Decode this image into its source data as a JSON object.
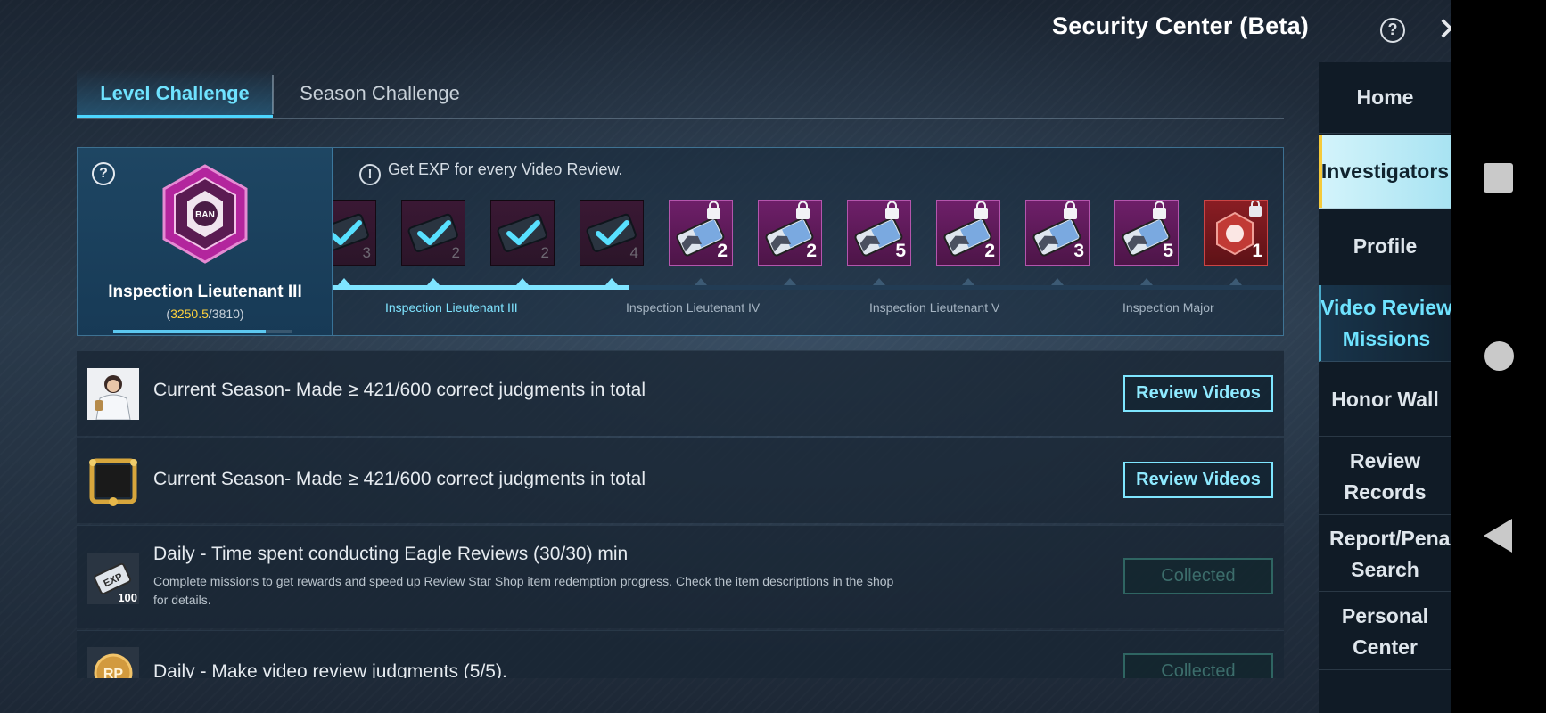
{
  "header": {
    "title": "Security Center (Beta)",
    "help_icon": "question-circle-icon",
    "close_icon": "close-icon"
  },
  "tabs": [
    {
      "label": "Level Challenge",
      "active": true
    },
    {
      "label": "Season Challenge",
      "active": false
    }
  ],
  "level": {
    "rank_name": "Inspection Lieutenant III",
    "exp_open": "(",
    "exp_current": "3250.5",
    "exp_rest": "/3810)",
    "exp_progress": 0.853,
    "hint": "Get EXP for every Video Review.",
    "rewards": [
      {
        "count": "3",
        "state": "done"
      },
      {
        "count": "2",
        "state": "done"
      },
      {
        "count": "2",
        "state": "done"
      },
      {
        "count": "4",
        "state": "done"
      },
      {
        "count": "2",
        "state": "locked"
      },
      {
        "count": "2",
        "state": "locked"
      },
      {
        "count": "5",
        "state": "locked"
      },
      {
        "count": "2",
        "state": "locked"
      },
      {
        "count": "3",
        "state": "locked"
      },
      {
        "count": "5",
        "state": "locked"
      },
      {
        "count": "1",
        "state": "locked-badge"
      }
    ],
    "track_progress": 0.31,
    "levels": [
      "Inspection Lieutenant III",
      "Inspection Lieutenant IV",
      "Inspection Lieutenant V",
      "Inspection Major"
    ]
  },
  "missions": [
    {
      "title": "Current Season- Made  ≥ 421/600 correct judgments in total",
      "description": "",
      "button": "Review Videos",
      "button_state": "active",
      "icon": "avatar-reward-icon"
    },
    {
      "title": "Current Season- Made  ≥ 421/600 correct judgments in total",
      "description": "",
      "button": "Review Videos",
      "button_state": "active",
      "icon": "gold-frame-icon"
    },
    {
      "title": "Daily - Time spent conducting Eagle Reviews (30/30) min",
      "description": "Complete missions to get rewards and speed up Review Star Shop item redemption progress. Check the item descriptions in the shop for details.",
      "button": "Collected",
      "button_state": "collected",
      "icon": "exp-card-icon",
      "icon_label": "100"
    },
    {
      "title": "Daily - Make video review judgments (5/5).",
      "description": "",
      "button": "Collected",
      "button_state": "collected",
      "icon": "rp-coin-icon"
    }
  ],
  "sidebar": [
    {
      "label": "Home",
      "state": "normal"
    },
    {
      "label": "Investigators",
      "state": "active"
    },
    {
      "label": "Profile",
      "state": "normal"
    },
    {
      "label": "Video Review Missions",
      "label_lines": [
        "Video Review",
        "Missions"
      ],
      "state": "hilite"
    },
    {
      "label": "Honor Wall",
      "state": "normal"
    },
    {
      "label": "Review Records",
      "label_lines": [
        "Review",
        "Records"
      ],
      "state": "normal"
    },
    {
      "label": "Report/Penalty Search",
      "label_lines": [
        "Report/Penalty",
        "Search"
      ],
      "state": "normal"
    },
    {
      "label": "Personal Center",
      "label_lines": [
        "Personal",
        "Center"
      ],
      "state": "normal"
    }
  ],
  "colors": {
    "accent": "#6fe3ff",
    "exp_highlight": "#ffd23d",
    "locked_reward": "#6e1f69",
    "active_side": "#d4f4fb"
  }
}
